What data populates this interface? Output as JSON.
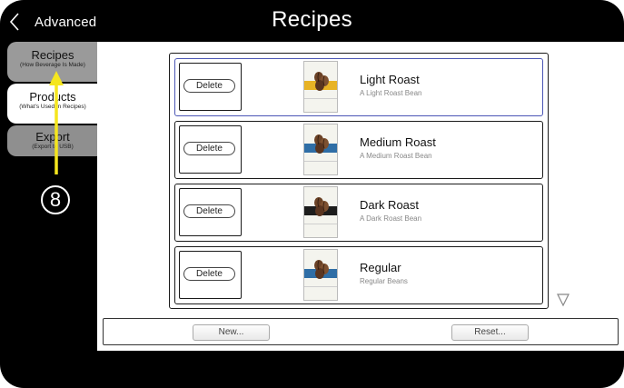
{
  "header": {
    "back_label": "Advanced",
    "title": "Recipes"
  },
  "sidebar": {
    "tabs": [
      {
        "title": "Recipes",
        "subtitle": "(How Beverage Is Made)",
        "state": "inactive"
      },
      {
        "title": "Products",
        "subtitle": "(What's Used In Recipes)",
        "state": "active"
      },
      {
        "title": "Export",
        "subtitle": "(Export to USB)",
        "state": "inactive"
      }
    ]
  },
  "annotation": {
    "step_number": "8",
    "color": "#f5e61e"
  },
  "recipes": [
    {
      "name": "Light Roast",
      "description": "A Light Roast Bean",
      "delete_label": "Delete",
      "band_color": "#e8b325",
      "selected": true
    },
    {
      "name": "Medium Roast",
      "description": "A Medium Roast Bean",
      "delete_label": "Delete",
      "band_color": "#2f6ea6",
      "selected": false
    },
    {
      "name": "Dark Roast",
      "description": "A Dark Roast Bean",
      "delete_label": "Delete",
      "band_color": "#1d1d1d",
      "selected": false
    },
    {
      "name": "Regular",
      "description": "Regular Beans",
      "delete_label": "Delete",
      "band_color": "#2f6ea6",
      "selected": false
    }
  ],
  "actions": {
    "new_label": "New...",
    "reset_label": "Reset..."
  },
  "colors": {
    "selected_border": "#4b56b5",
    "frame": "#000000",
    "inactive_tab": "#9a9a9a"
  }
}
